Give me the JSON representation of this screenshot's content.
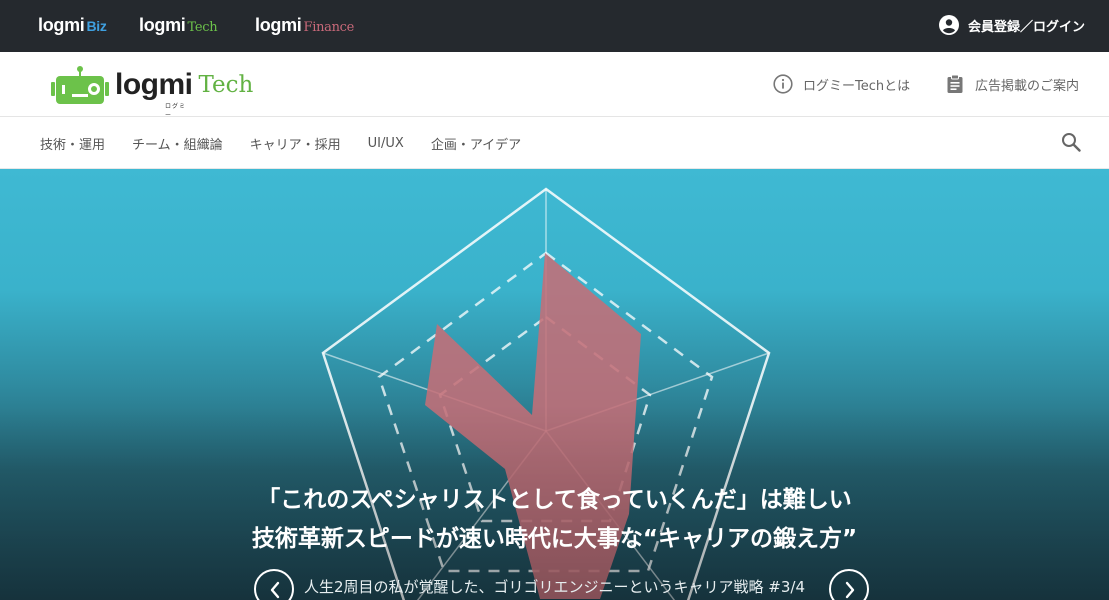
{
  "topbar": {
    "brands": [
      {
        "main": "logmi",
        "sub": "Biz"
      },
      {
        "main": "logmi",
        "sub": "Tech"
      },
      {
        "main": "logmi",
        "sub": "Finance"
      }
    ],
    "login_label": "会員登録／ログイン",
    "icon": "account-circle-icon"
  },
  "header": {
    "logo": {
      "word": "logmi",
      "kana": "ログミー",
      "sub": "Tech"
    },
    "about_label": "ログミーTechとは",
    "ads_label": "広告掲載のご案内"
  },
  "nav": {
    "items": [
      "技術・運用",
      "チーム・組織論",
      "キャリア・採用",
      "UI/UX",
      "企画・アイデア"
    ]
  },
  "hero": {
    "title_line1": "「これのスペシャリストとして食っていくんだ」は難しい",
    "title_line2": "技術革新スピードが速い時代に大事な“キャリアの鍛え方”",
    "subtitle": "人生2周目の私が覚醒した、ゴリゴリエンジニーというキャリア戦略 #3/4"
  },
  "colors": {
    "topbar": "#25292e",
    "biz": "#3fa0e0",
    "tech": "#62b243",
    "finance": "#c9697a",
    "hero_top": "#3fb9d3",
    "radar_fill": "#c46e77"
  }
}
